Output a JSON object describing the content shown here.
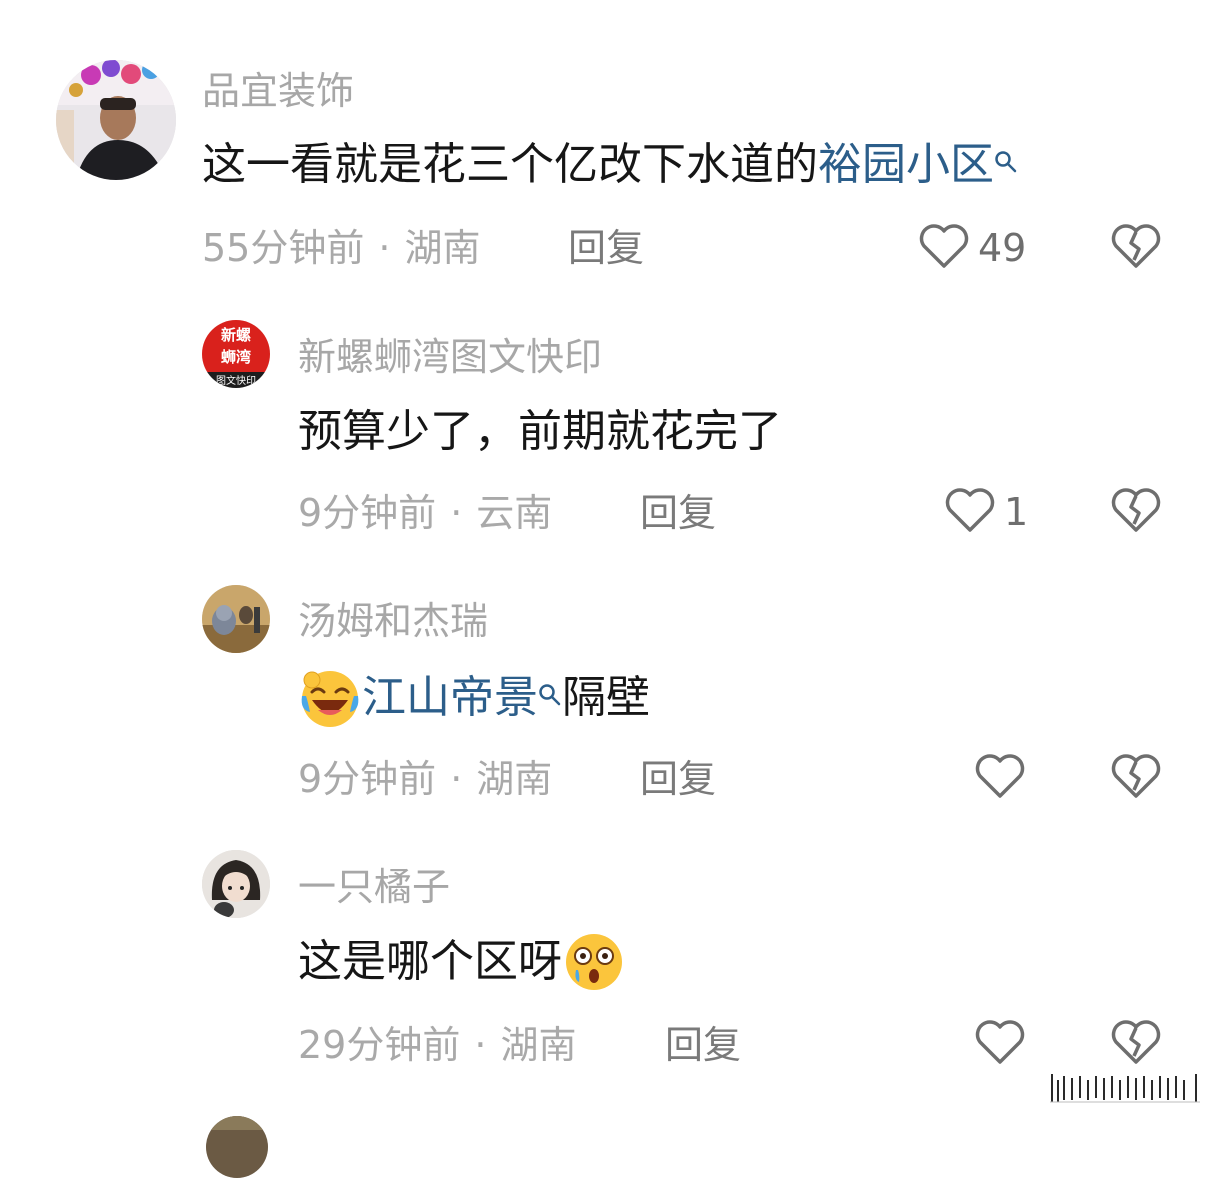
{
  "comments": [
    {
      "username": "品宜装饰",
      "text_before": "这一看就是花三个亿改下水道的",
      "link_text": "裕园小区",
      "text_after": "",
      "time": "55分钟前",
      "location": "湖南",
      "reply_label": "回复",
      "likes": "49"
    },
    {
      "username": "新螺蛳湾图文快印",
      "avatar_text_1": "新螺",
      "avatar_text_2": "蛳湾",
      "avatar_text_3": "图文快印",
      "text": "预算少了，前期就花完了",
      "time": "9分钟前",
      "location": "云南",
      "reply_label": "回复",
      "likes": "1"
    },
    {
      "username": "汤姆和杰瑞",
      "link_text": "江山帝景",
      "text_after": "隔壁",
      "time": "9分钟前",
      "location": "湖南",
      "reply_label": "回复",
      "likes": ""
    },
    {
      "username": "一只橘子",
      "text": "这是哪个区呀",
      "time": "29分钟前",
      "location": "湖南",
      "reply_label": "回复",
      "likes": ""
    }
  ],
  "separator": "·",
  "colors": {
    "username": "#a7a7a7",
    "text": "#161616",
    "link": "#2c5e8a",
    "meta": "#a9a9a9",
    "icon": "#6e6e6e"
  }
}
